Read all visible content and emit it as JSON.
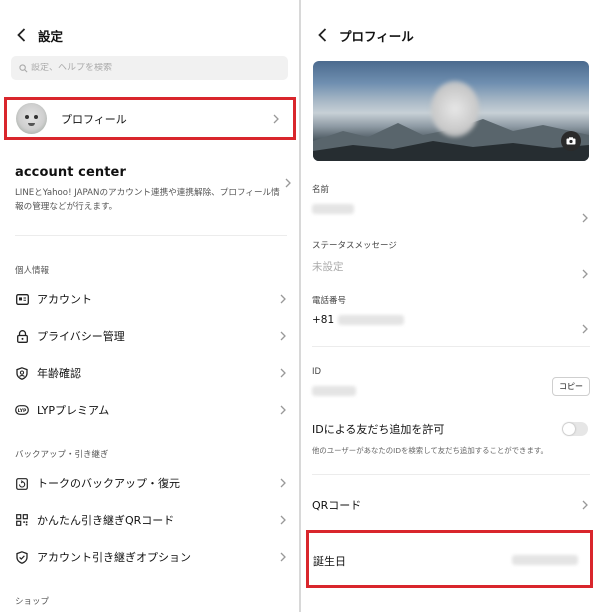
{
  "left": {
    "title": "設定",
    "search_placeholder": "設定、ヘルプを検索",
    "profile_label": "プロフィール",
    "account_center": {
      "title": "account center",
      "description": "LINEとYahoo! JAPANのアカウント連携や連携解除、プロフィール情報の管理などが行えます。"
    },
    "section_personal": "個人情報",
    "personal_items": [
      {
        "label": "アカウント",
        "icon": "id-card-icon"
      },
      {
        "label": "プライバシー管理",
        "icon": "lock-icon"
      },
      {
        "label": "年齢確認",
        "icon": "shield-icon"
      },
      {
        "label": "LYPプレミアム",
        "icon": "lyp-icon"
      }
    ],
    "section_backup": "バックアップ・引き継ぎ",
    "backup_items": [
      {
        "label": "トークのバックアップ・復元",
        "icon": "backup-icon"
      },
      {
        "label": "かんたん引き継ぎQRコード",
        "icon": "qr-code-icon"
      },
      {
        "label": "アカウント引き継ぎオプション",
        "icon": "shield-check-icon"
      }
    ],
    "section_shop": "ショップ"
  },
  "right": {
    "title": "プロフィール",
    "name_label": "名前",
    "status_label": "ステータスメッセージ",
    "status_value": "未設定",
    "phone_label": "電話番号",
    "phone_prefix": "+81",
    "id_label": "ID",
    "copy_label": "コピー",
    "allow_id_title": "IDによる友だち追加を許可",
    "allow_id_desc": "他のユーザーがあなたのIDを検索して友だち追加することができます。",
    "qr_label": "QRコード",
    "birthday_label": "誕生日"
  },
  "colors": {
    "highlight": "#d9262c",
    "separator": "#ececec",
    "muted_text": "#aaaaaa"
  }
}
